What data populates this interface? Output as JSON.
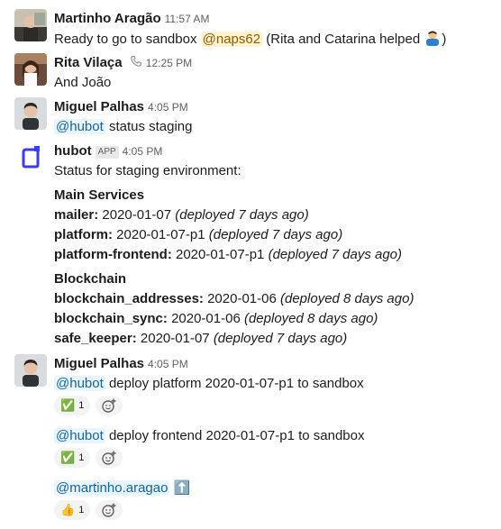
{
  "messages": [
    {
      "author": "Martinho Aragão",
      "time": "11:57 AM",
      "prefix": "Ready to go to sandbox",
      "mention": "@naps62",
      "suffix": "(Rita and Catarina helped",
      "close": ")"
    },
    {
      "author": "Rita Vilaça",
      "time": "12:25 PM",
      "text": "And João"
    },
    {
      "author": "Miguel Palhas",
      "time": "4:05 PM",
      "mention": "@hubot",
      "text": "status staging"
    },
    {
      "author": "hubot",
      "badge": "APP",
      "time": "4:05 PM",
      "intro": "Status for staging environment:",
      "sections": [
        {
          "title": "Main Services",
          "rows": [
            {
              "key": "mailer:",
              "date": "2020-01-07",
              "note": "(deployed 7 days ago)"
            },
            {
              "key": "platform:",
              "date": "2020-01-07-p1",
              "note": "(deployed 7 days ago)"
            },
            {
              "key": "platform-frontend:",
              "date": "2020-01-07-p1",
              "note": "(deployed 7 days ago)"
            }
          ]
        },
        {
          "title": "Blockchain",
          "rows": [
            {
              "key": "blockchain_addresses:",
              "date": "2020-01-06",
              "note": "(deployed 8 days ago)"
            },
            {
              "key": "blockchain_sync:",
              "date": "2020-01-06",
              "note": "(deployed 8 days ago)"
            },
            {
              "key": "safe_keeper:",
              "date": "2020-01-07",
              "note": "(deployed 7 days ago)"
            }
          ]
        }
      ]
    },
    {
      "author": "Miguel Palhas",
      "time": "4:05 PM",
      "posts": [
        {
          "mention": "@hubot",
          "text": "deploy platform 2020-01-07-p1 to sandbox",
          "reaction_emoji": "✅",
          "reaction_count": "1"
        },
        {
          "mention": "@hubot",
          "text": "deploy frontend 2020-01-07-p1 to sandbox",
          "reaction_emoji": "✅",
          "reaction_count": "1"
        },
        {
          "mention": "@martinho.aragao",
          "text": "⬆️",
          "reaction_emoji": "👍",
          "reaction_count": "1"
        }
      ]
    }
  ],
  "colors": {
    "mention": "#1264a3",
    "mention_bg": "#e8f5fa",
    "self_mention_bg": "#fdf1cf",
    "hubot_brand": "#3b3bf0"
  },
  "icons": [
    "phone-icon",
    "add-reaction-icon",
    "person-emoji-icon",
    "hubot-logo"
  ]
}
